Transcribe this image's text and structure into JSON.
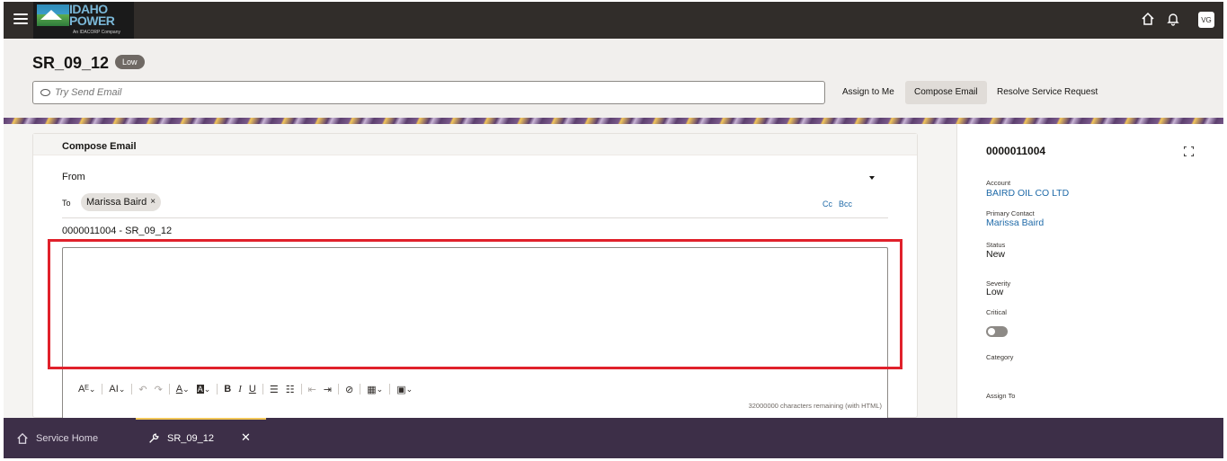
{
  "topbar": {
    "logo_text_line1": "IDAHO",
    "logo_text_line2": "POWER",
    "logo_sub": "An IDACORP Company",
    "avatar_initials": "VG"
  },
  "header": {
    "title": "SR_09_12",
    "priority": "Low",
    "search_placeholder": "Try Send Email",
    "actions": [
      "Assign to Me",
      "Compose Email",
      "Resolve Service Request"
    ],
    "active_action": "Compose Email"
  },
  "compose": {
    "title": "Compose Email",
    "from_label": "From",
    "to_label": "To",
    "recipient": "Marissa Baird",
    "chip_close": "×",
    "cc": "Cc",
    "bcc": "Bcc",
    "subject": "0000011004 - SR_09_12",
    "chars_remaining": "32000000 characters remaining (with HTML)",
    "toolbar_icons": [
      "font-size-icon",
      "text-size-icon",
      "undo-icon",
      "redo-icon",
      "font-color-icon",
      "highlight-color-icon",
      "bold-icon",
      "italic-icon",
      "underline-icon",
      "bullet-list-icon",
      "numbered-list-icon",
      "outdent-icon",
      "indent-icon",
      "link-icon",
      "table-icon",
      "insert-image-icon"
    ],
    "toolbar_glyphs": {
      "font_size": "Aᴱ",
      "text_size": "AI",
      "undo": "↶",
      "redo": "↷",
      "font_color": "A",
      "highlight": "A",
      "bold": "B",
      "italic": "I",
      "underline": "U",
      "bullets": "☰",
      "numbered": "☷",
      "outdent": "⇤",
      "indent": "⇥",
      "link": "⊘",
      "table": "▦",
      "image": "▣",
      "caret": "⌄"
    }
  },
  "details": {
    "title": "0000011004",
    "account_label": "Account",
    "account_value": "BAIRD OIL CO LTD",
    "contact_label": "Primary Contact",
    "contact_value": "Marissa Baird",
    "status_label": "Status",
    "status_value": "New",
    "severity_label": "Severity",
    "severity_value": "Low",
    "critical_label": "Critical",
    "critical_on": false,
    "category_label": "Category",
    "assign_label": "Assign To"
  },
  "tabs": {
    "home": "Service Home",
    "current": "SR_09_12",
    "close": "✕"
  },
  "colors": {
    "topbar": "#312d2a",
    "tabbar": "#3d2f48",
    "link": "#1f6aa8",
    "highlight_box": "#e0212b",
    "tab_indicator": "#f3c75a"
  }
}
